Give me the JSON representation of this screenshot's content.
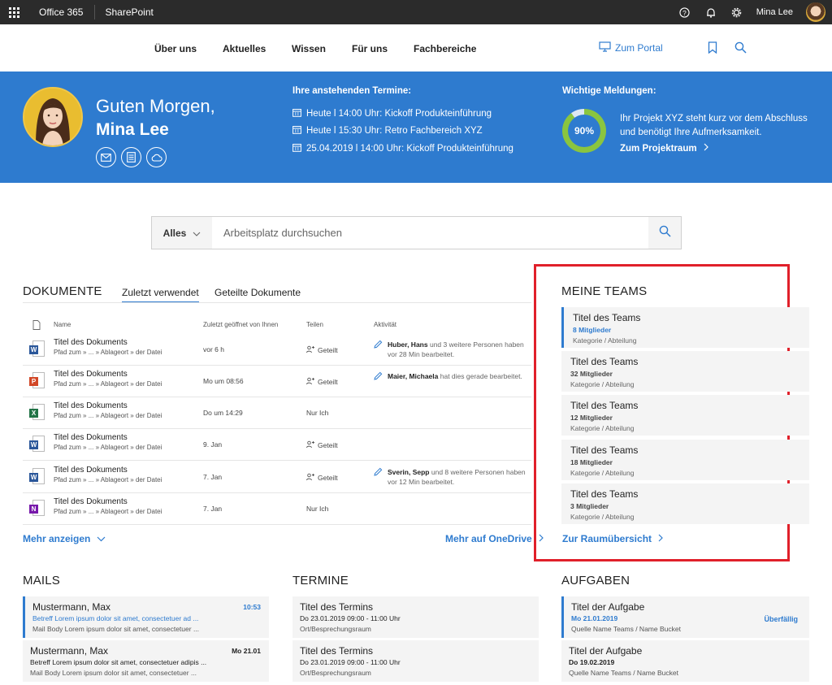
{
  "suitebar": {
    "app": "Office 365",
    "site": "SharePoint",
    "user": "Mina Lee"
  },
  "nav": {
    "items": [
      "Über uns",
      "Aktuelles",
      "Wissen",
      "Für uns",
      "Fachbereiche"
    ],
    "portal": "Zum Portal"
  },
  "hero": {
    "greeting": "Guten Morgen,",
    "name": "Mina Lee",
    "appointments_title": "Ihre anstehenden Termine:",
    "appointments": [
      "Heute l 14:00 Uhr:  Kickoff Produkteinführung",
      "Heute l 15:30 Uhr:  Retro Fachbereich XYZ",
      "25.04.2019 l 14:00 Uhr:  Kickoff Produkteinführung"
    ],
    "news_title": "Wichtige Meldungen:",
    "progress_label": "90%",
    "progress": 0.9,
    "news_text": "Ihr Projekt XYZ steht kurz vor dem Abschluss und benötigt Ihre Aufmerksamkeit.",
    "news_link": "Zum Projektraum"
  },
  "search": {
    "scope": "Alles",
    "placeholder": "Arbeitsplatz durchsuchen"
  },
  "documents": {
    "title": "DOKUMENTE",
    "tabs": [
      "Zuletzt verwendet",
      "Geteilte Dokumente"
    ],
    "headers": [
      "Name",
      "Zuletzt geöffnet von Ihnen",
      "Teilen",
      "Aktivität"
    ],
    "rows": [
      {
        "type": "W",
        "color": "#2b579a",
        "title": "Titel des Dokuments",
        "path": "Pfad zum » ... » Ablageort » der Datei",
        "time": "vor 6 h",
        "share": "Geteilt",
        "act_name": "Huber, Hans",
        "act_text": " und 3 weitere Personen haben vor 28 Min bearbeitet."
      },
      {
        "type": "P",
        "color": "#d24726",
        "title": "Titel des Dokuments",
        "path": "Pfad zum » ... » Ablageort » der Datei",
        "time": "Mo um 08:56",
        "share": "Geteilt",
        "act_name": "Maier, Michaela",
        "act_text": " hat dies gerade bearbeitet."
      },
      {
        "type": "X",
        "color": "#217346",
        "title": "Titel des Dokuments",
        "path": "Pfad zum » ... » Ablageort » der Datei",
        "time": "Do um 14:29",
        "share": "Nur Ich",
        "act_name": "",
        "act_text": ""
      },
      {
        "type": "W",
        "color": "#2b579a",
        "title": "Titel des Dokuments",
        "path": "Pfad zum » ... » Ablageort » der Datei",
        "time": "9. Jan",
        "share": "Geteilt",
        "act_name": "",
        "act_text": ""
      },
      {
        "type": "W",
        "color": "#2b579a",
        "title": "Titel des Dokuments",
        "path": "Pfad zum » ... » Ablageort » der Datei",
        "time": "7. Jan",
        "share": "Geteilt",
        "act_name": "Sverin, Sepp",
        "act_text": " und 8 weitere Personen haben vor 12 Min bearbeitet."
      },
      {
        "type": "N",
        "color": "#7719aa",
        "title": "Titel des Dokuments",
        "path": "Pfad zum » ... » Ablageort » der Datei",
        "time": "7. Jan",
        "share": "Nur Ich",
        "act_name": "",
        "act_text": ""
      }
    ],
    "more": "Mehr anzeigen",
    "onedrive": "Mehr auf OneDrive"
  },
  "teams": {
    "title": "MEINE TEAMS",
    "items": [
      {
        "title": "Titel des Teams",
        "members": "8 Mitglieder",
        "meta": "Kategorie / Abteilung"
      },
      {
        "title": "Titel des Teams",
        "members": "32 Mitglieder",
        "meta": "Kategorie / Abteilung"
      },
      {
        "title": "Titel des Teams",
        "members": "12 Mitglieder",
        "meta": "Kategorie / Abteilung"
      },
      {
        "title": "Titel des Teams",
        "members": "18 Mitglieder",
        "meta": "Kategorie / Abteilung"
      },
      {
        "title": "Titel des Teams",
        "members": "3 Mitglieder",
        "meta": "Kategorie / Abteilung"
      }
    ],
    "link": "Zur Raumübersicht"
  },
  "mails": {
    "title": "MAILS",
    "items": [
      {
        "from": "Mustermann, Max",
        "time": "10:53",
        "subject": "Betreff Lorem ipsum dolor sit amet, consectetuer ad ...",
        "body": "Mail Body Lorem ipsum dolor sit amet, consectetuer ..."
      },
      {
        "from": "Mustermann, Max",
        "time": "Mo 21.01",
        "subject": "Betreff Lorem ipsum dolor sit amet, consectetuer adipis ...",
        "body": "Mail Body Lorem ipsum dolor sit amet, consectetuer ..."
      }
    ]
  },
  "termine": {
    "title": "TERMINE",
    "items": [
      {
        "title": "Titel des Termins",
        "when": "Do 23.01.2019    09:00 - 11:00 Uhr",
        "where": "Ort/Besprechungsraum"
      },
      {
        "title": "Titel des Termins",
        "when": "Do 23.01.2019    09:00 - 11:00 Uhr",
        "where": "Ort/Besprechungsraum"
      }
    ]
  },
  "aufgaben": {
    "title": "AUFGABEN",
    "items": [
      {
        "title": "Titel der Aufgabe",
        "date": "Mo 21.01.2019",
        "status": "Überfällig",
        "meta": "Quelle Name Teams / Name Bucket"
      },
      {
        "title": "Titel der Aufgabe",
        "date": "Do 19.02.2019",
        "status": "",
        "meta": "Quelle Name Teams / Name Bucket"
      }
    ]
  }
}
